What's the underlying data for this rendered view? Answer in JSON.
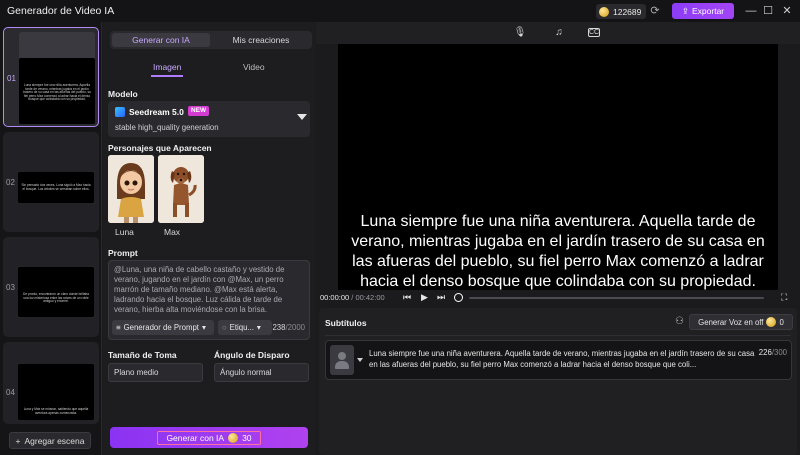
{
  "window": {
    "title": "Generador de Video IA",
    "credits": "122689",
    "export_label": "Exportar"
  },
  "scenes": {
    "items": [
      {
        "number": "01",
        "text": "Luna siempre fue una niña aventurera. Aquella tarde de verano, mientras jugaba en el jardín trasero de su casa en las afueras del pueblo, su fiel perro Max comenzó a ladrar hacia el denso bosque que colindaba con su propiedad."
      },
      {
        "number": "02",
        "text": "Sin pensarlo dos veces, Luna siguió a Max hacia el bosque. Los árboles se cerraban sobre ellos."
      },
      {
        "number": "03",
        "text": "De pronto, encontraron un claro donde brillaba una luz misteriosa entre las raíces de un roble antiguo y enorme."
      },
      {
        "number": "04",
        "text": "Luna y Max se miraron, sabiendo que aquella aventura apenas comenzaba."
      }
    ],
    "add_label": "Agregar escena"
  },
  "panel": {
    "tabs": [
      "Generar con IA",
      "Mis creaciones"
    ],
    "subtabs": [
      "Imagen",
      "Video"
    ],
    "model_label": "Modelo",
    "model": {
      "name": "Seedream 5.0",
      "badge": "NEW",
      "description": "stable high_quality generation"
    },
    "characters_label": "Personajes que Aparecen",
    "characters": [
      {
        "name": "Luna"
      },
      {
        "name": "Max"
      }
    ],
    "prompt_label": "Prompt",
    "prompt_text": "@Luna, una niña de cabello castaño y vestido de verano, jugando en el jardín con @Max, un perro marrón de tamaño mediano. @Max está alerta, ladrando hacia el bosque. Luz cálida de tarde de verano, hierba alta moviéndose con la brisa.",
    "prompt_generator_label": "Generador de Prompt",
    "tags_label": "Etiqu...",
    "char_count": "238",
    "char_max": "/2000",
    "shot_size_label": "Tamaño de Toma",
    "shot_size_value": "Plano medio",
    "shot_angle_label": "Ángulo de Disparo",
    "shot_angle_value": "Ángulo normal",
    "generate_label": "Generar con IA",
    "generate_cost": "30"
  },
  "preview": {
    "caption": "Luna siempre fue una niña aventurera. Aquella tarde de verano, mientras jugaba en el jardín trasero de su casa en las afueras del pueblo, su fiel perro Max comenzó a ladrar hacia el denso bosque que colindaba con su propiedad.",
    "time_current": "00:00:00",
    "time_total": "/ 00:42:00"
  },
  "subtitles": {
    "title": "Subtítulos",
    "voice_button_label": "Generar Voz en off",
    "voice_cost": "0",
    "rows": [
      {
        "text": "Luna siempre fue una niña aventurera. Aquella tarde de verano, mientras jugaba en el jardín trasero de su casa en las afueras del pueblo, su fiel perro Max comenzó a ladrar hacia el denso bosque que coli...",
        "count": "226",
        "max": "/300"
      }
    ]
  },
  "colors": {
    "accent": "#a345f5",
    "accent_text": "#c9a9ff",
    "background": "#1b1b1d"
  }
}
